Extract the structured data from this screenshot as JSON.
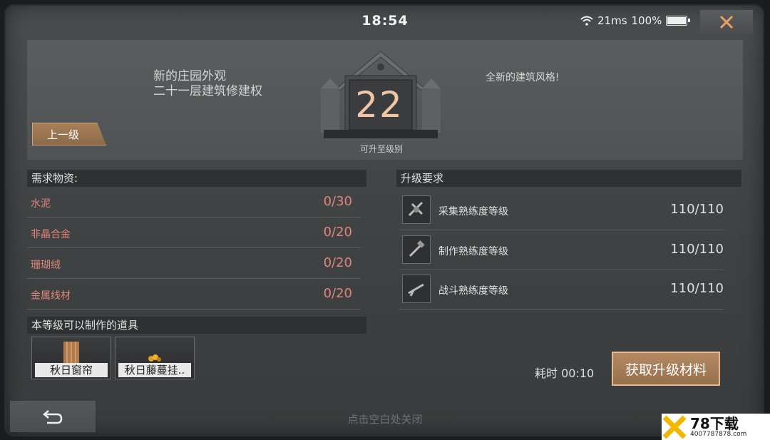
{
  "status": {
    "time": "18:54",
    "ping": "21ms",
    "battery": "100%"
  },
  "header": {
    "desc_line1": "新的庄园外观",
    "desc_line2": "二十一层建筑修建权",
    "desc_right": "全新的建筑风格!",
    "level": "22",
    "level_caption": "可升至级别",
    "prev_level_label": "上一级"
  },
  "materials": {
    "title": "需求物资:",
    "items": [
      {
        "name": "水泥",
        "count": "0/30"
      },
      {
        "name": "非晶合金",
        "count": "0/20"
      },
      {
        "name": "珊瑚绒",
        "count": "0/20"
      },
      {
        "name": "金属线材",
        "count": "0/20"
      }
    ]
  },
  "requirements": {
    "title": "升级要求",
    "items": [
      {
        "name": "采集熟练度等级",
        "value": "110/110",
        "icon": "gather-icon"
      },
      {
        "name": "制作熟练度等级",
        "value": "110/110",
        "icon": "craft-icon"
      },
      {
        "name": "战斗熟练度等级",
        "value": "110/110",
        "icon": "combat-icon"
      }
    ]
  },
  "craftable": {
    "title": "本等级可以制作的道具",
    "items": [
      {
        "name": "秋日窗帘"
      },
      {
        "name": "秋日藤蔓挂.."
      }
    ]
  },
  "footer": {
    "time_label": "耗时 00:10",
    "get_materials_label": "获取升级材料",
    "close_hint": "点击空白处关闭"
  },
  "watermark": {
    "brand": "78下载",
    "sub": "4007787878.com"
  },
  "colors": {
    "accent": "#e0857a",
    "button": "#a88058",
    "level": "#f0c5a6"
  }
}
